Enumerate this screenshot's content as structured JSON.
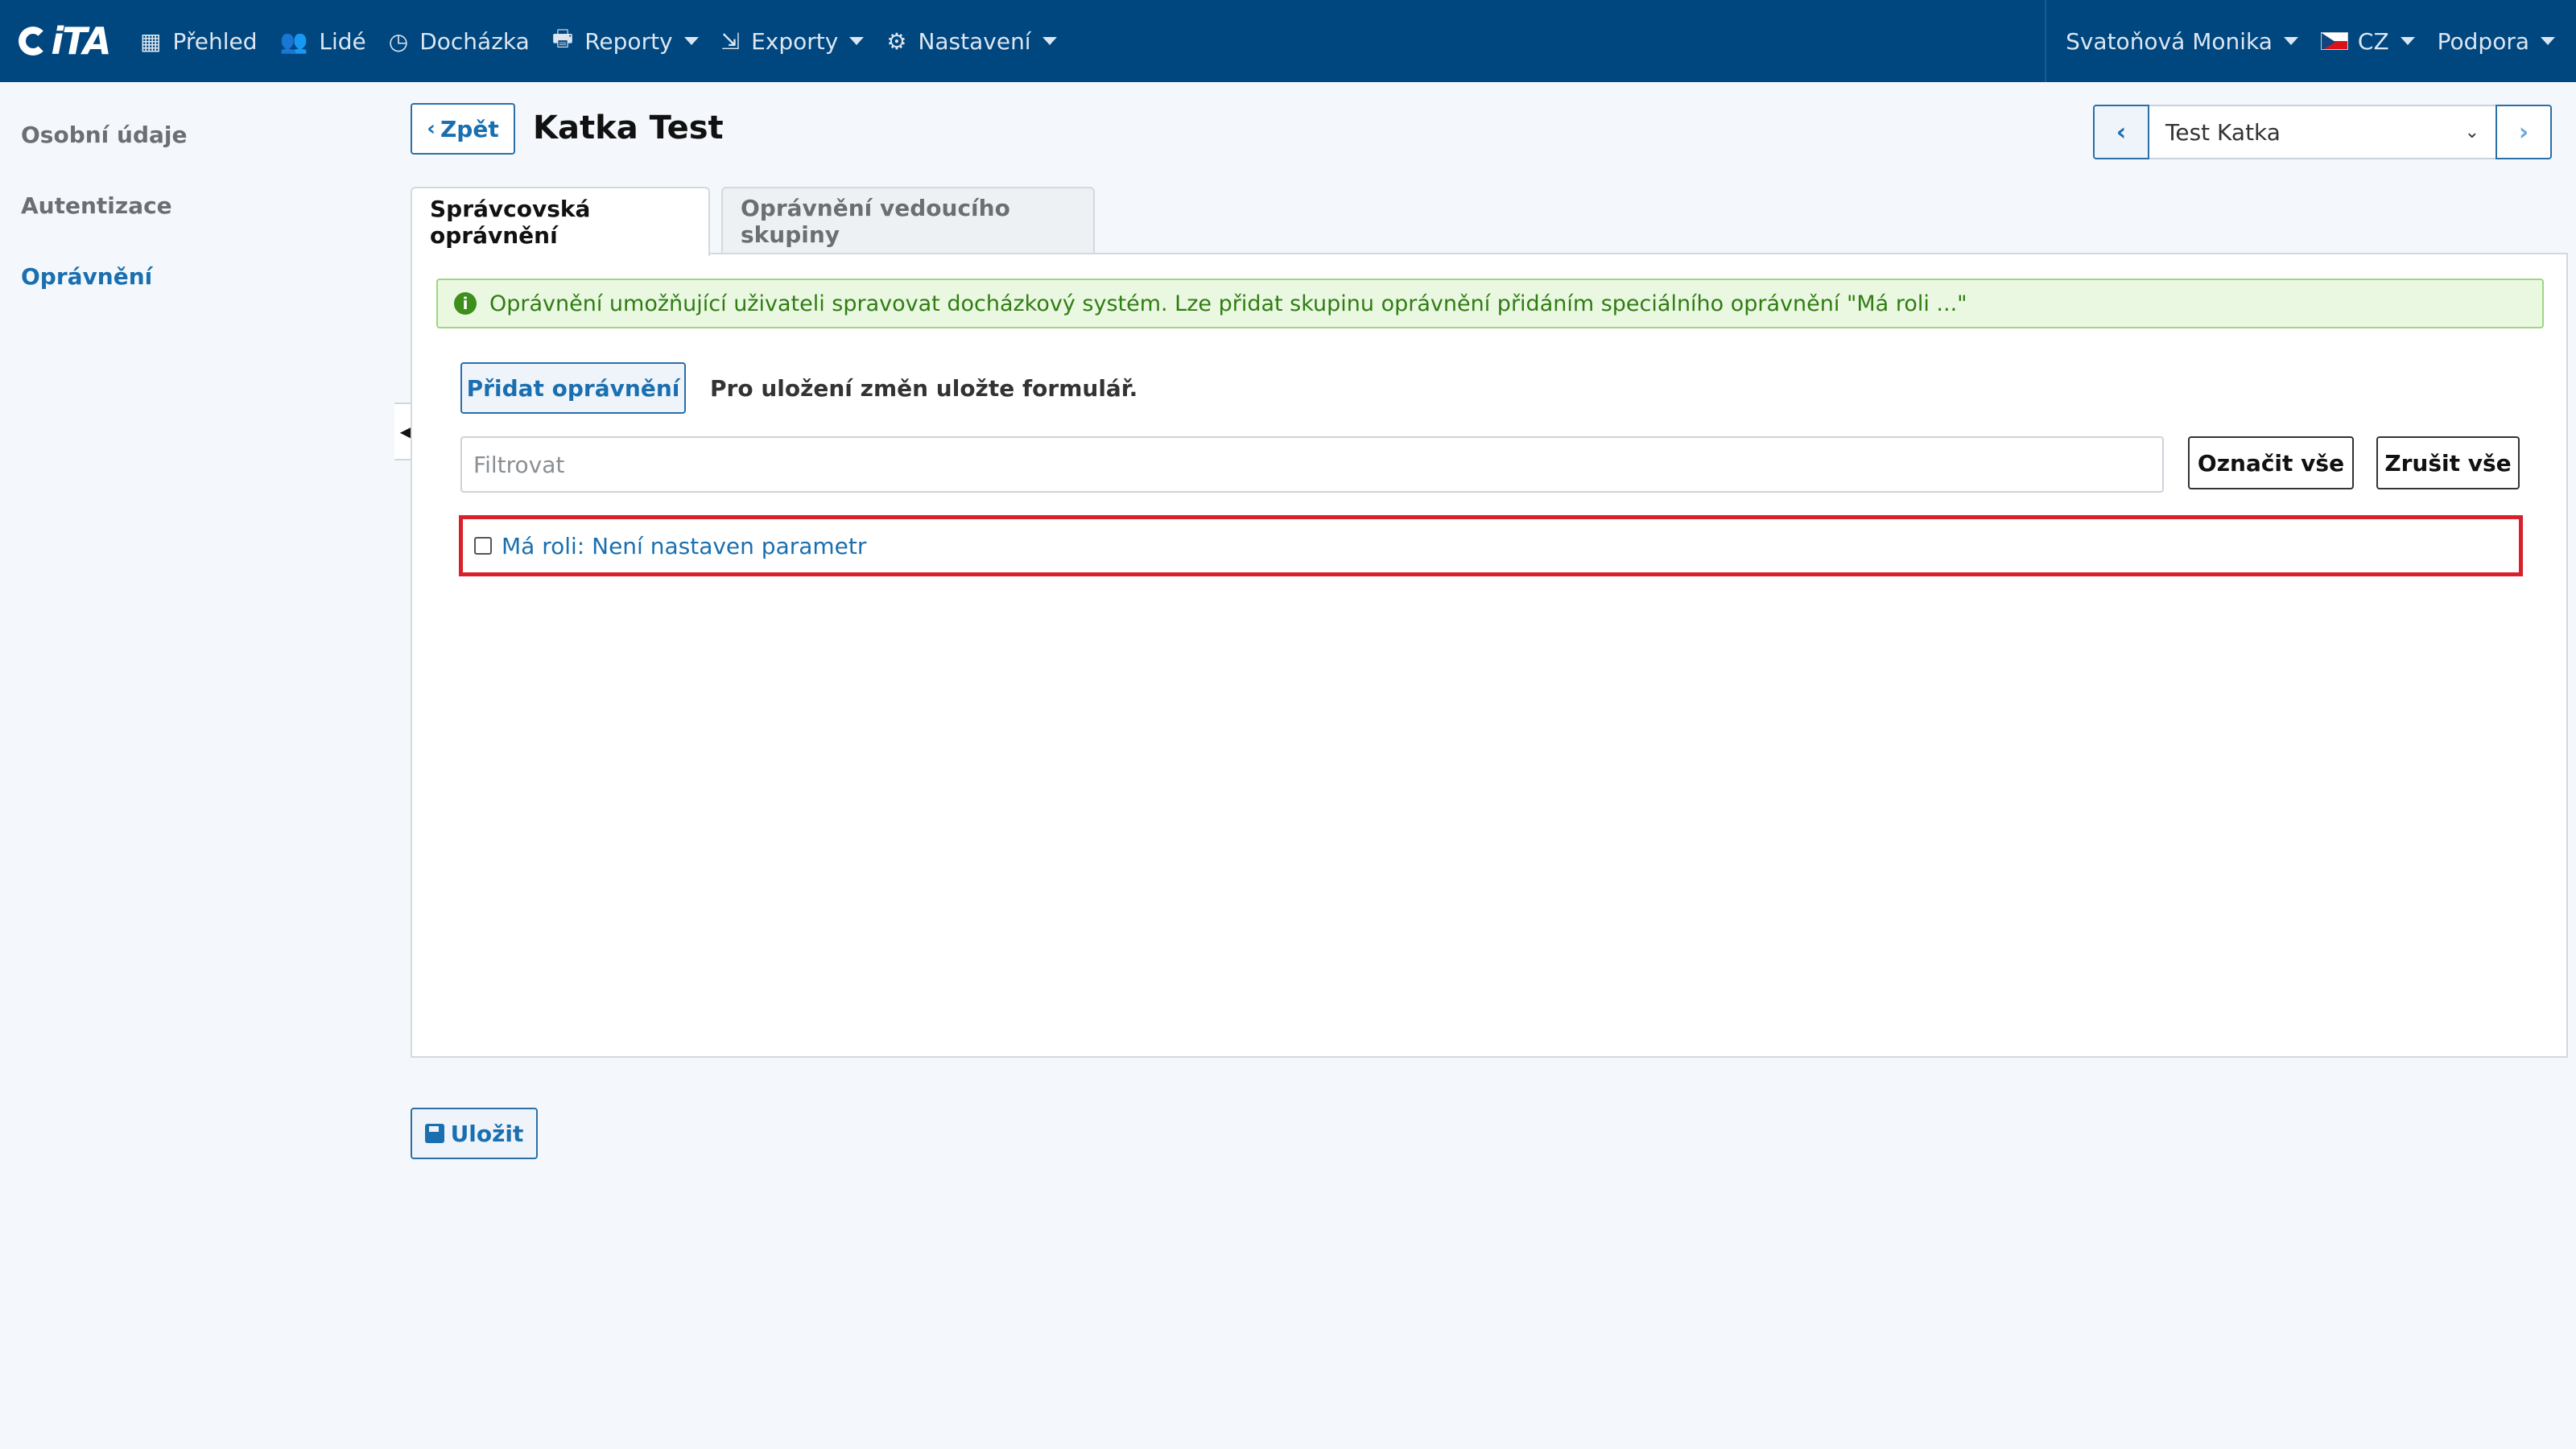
{
  "brand": {
    "logo_text": "iTA"
  },
  "nav": {
    "items": [
      {
        "label": "Přehled",
        "icon": "grid-icon",
        "glyph": "▦",
        "dropdown": false
      },
      {
        "label": "Lidé",
        "icon": "users-icon",
        "glyph": "👥",
        "dropdown": false
      },
      {
        "label": "Docházka",
        "icon": "clock-icon",
        "glyph": "◷",
        "dropdown": false
      },
      {
        "label": "Reporty",
        "icon": "printer-icon",
        "glyph": "🖶",
        "dropdown": true
      },
      {
        "label": "Exporty",
        "icon": "export-icon",
        "glyph": "⇲",
        "dropdown": true
      },
      {
        "label": "Nastavení",
        "icon": "gear-icon",
        "glyph": "⚙",
        "dropdown": true
      }
    ],
    "user": "Svatoňová Monika",
    "language": "CZ",
    "support": "Podpora"
  },
  "sidebar": {
    "items": [
      {
        "label": "Osobní údaje",
        "active": false
      },
      {
        "label": "Autentizace",
        "active": false
      },
      {
        "label": "Oprávnění",
        "active": true
      }
    ]
  },
  "header": {
    "back_label": "Zpět",
    "title": "Katka Test",
    "person_select_value": "Test Katka"
  },
  "tabs": [
    {
      "label": "Správcovská oprávnění",
      "active": true
    },
    {
      "label": "Oprávnění vedoucího skupiny",
      "active": false
    }
  ],
  "panel": {
    "alert_text": "Oprávnění umožňující uživateli spravovat docházkový systém. Lze přidat skupinu oprávnění přidáním speciálního oprávnění \"Má roli ...\"",
    "add_button": "Přidat oprávnění",
    "save_note": "Pro uložení změn uložte formulář.",
    "filter_placeholder": "Filtrovat",
    "select_all": "Označit vše",
    "clear_all": "Zrušit vše",
    "permissions": [
      {
        "label": "Má roli: Není nastaven parametr",
        "checked": false
      }
    ]
  },
  "footer": {
    "save_label": "Uložit"
  },
  "colors": {
    "navbar": "#00467f",
    "accent": "#1a6fb0",
    "alert_bg": "#eaf8e2",
    "highlight_border": "#d8202a"
  }
}
